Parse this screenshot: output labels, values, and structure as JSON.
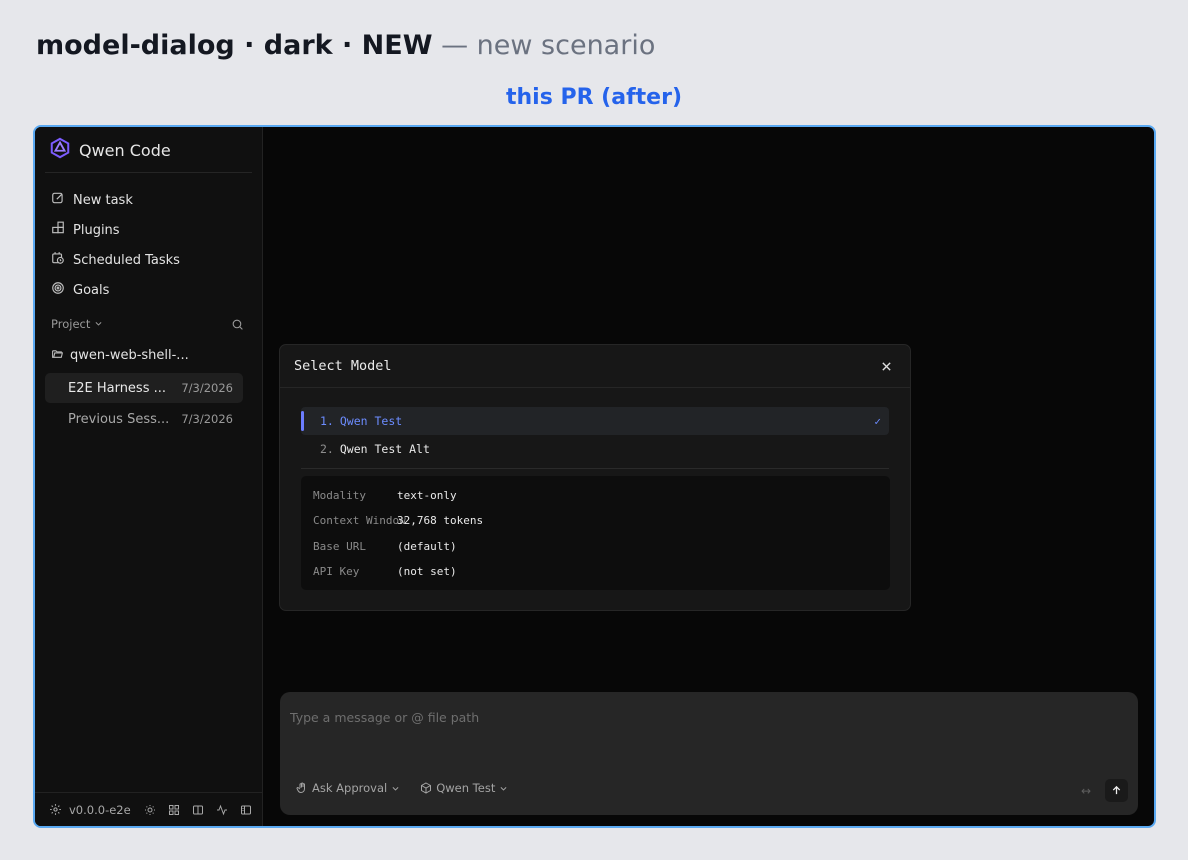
{
  "header": {
    "title": "model-dialog · dark · NEW",
    "subtitle": "— new scenario",
    "caption": "this PR (after)"
  },
  "sidebar": {
    "brand": "Qwen Code",
    "nav": [
      {
        "label": "New task",
        "icon": "edit-icon"
      },
      {
        "label": "Plugins",
        "icon": "plugins-icon"
      },
      {
        "label": "Scheduled Tasks",
        "icon": "calendar-clock-icon"
      },
      {
        "label": "Goals",
        "icon": "target-icon"
      }
    ],
    "project_label": "Project",
    "folder": "qwen-web-shell-...",
    "sessions": [
      {
        "title": "E2E Harness ...",
        "date": "7/3/2026",
        "active": true
      },
      {
        "title": "Previous Sess...",
        "date": "7/3/2026",
        "active": false
      }
    ],
    "version": "v0.0.0-e2e"
  },
  "dialog": {
    "title": "Select Model",
    "models": [
      {
        "index": "1.",
        "name": "Qwen Test",
        "selected": true,
        "check": "✓"
      },
      {
        "index": "2.",
        "name": "Qwen Test Alt",
        "selected": false
      }
    ],
    "details": [
      {
        "key": "Modality",
        "value": "text-only"
      },
      {
        "key": "Context Window",
        "value": "32,768 tokens"
      },
      {
        "key": "Base URL",
        "value": "(default)"
      },
      {
        "key": "API Key",
        "value": "(not set)"
      }
    ]
  },
  "composer": {
    "placeholder": "Type a message or @ file path",
    "approval_mode": "Ask Approval",
    "model": "Qwen Test",
    "expand_glyph": "↔"
  },
  "colors": {
    "page_bg": "#e6e7eb",
    "accent": "#2563eb",
    "frame_border": "#5aa9f2",
    "selected_model": "#6c8cff"
  }
}
